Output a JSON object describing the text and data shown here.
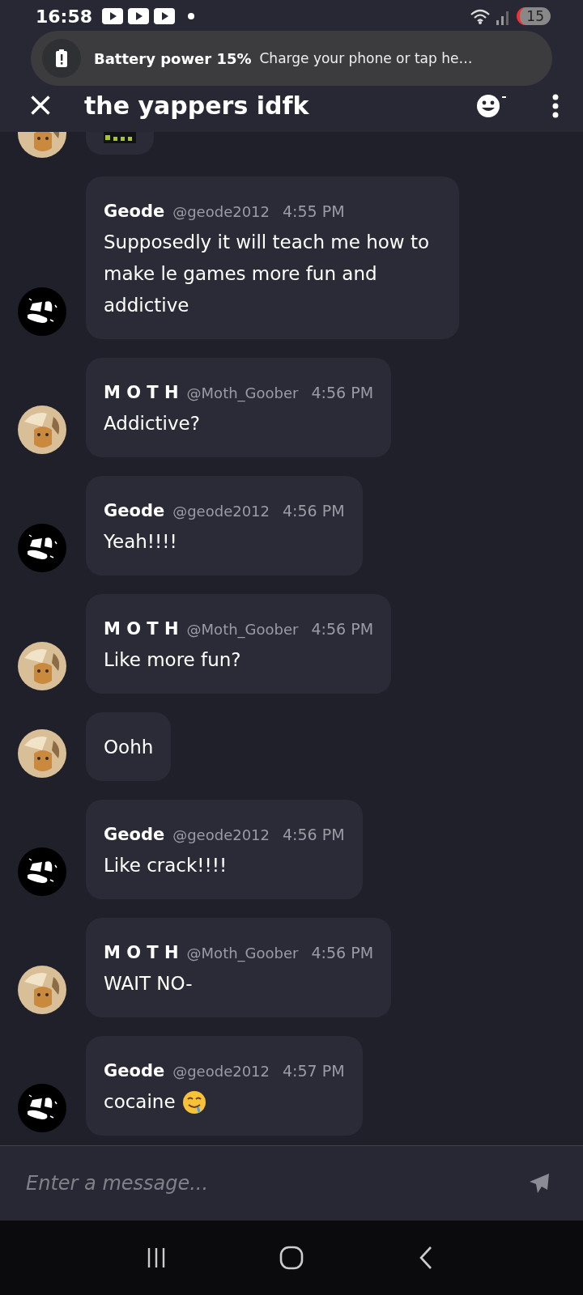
{
  "status_bar": {
    "time": "16:58",
    "battery": "15"
  },
  "notification": {
    "title": "Battery power 15%",
    "text": "Charge your phone or tap he…"
  },
  "header": {
    "title": "the yappers idfk"
  },
  "messages": [
    {
      "kind": "moth"
    },
    {
      "kind": "geode",
      "name": "Geode",
      "handle": "@geode2012",
      "time": "4:55 PM",
      "text": "Supposedly it will teach me how to make le games more fun and addictive",
      "emoji": false
    },
    {
      "kind": "moth",
      "name": "M O T H",
      "handle": "@Moth_Goober",
      "time": "4:56 PM",
      "text": "Addictive?",
      "emoji": false
    },
    {
      "kind": "geode",
      "name": "Geode",
      "handle": "@geode2012",
      "time": "4:56 PM",
      "text": "Yeah!!!!",
      "emoji": false
    },
    {
      "kind": "moth",
      "name": "M O T H",
      "handle": "@Moth_Goober",
      "time": "4:56 PM",
      "text": "Like more fun?",
      "emoji": false
    },
    {
      "kind": "moth",
      "text": "Oohh",
      "emoji": false
    },
    {
      "kind": "geode",
      "name": "Geode",
      "handle": "@geode2012",
      "time": "4:56 PM",
      "text": "Like crack!!!!",
      "emoji": false
    },
    {
      "kind": "moth",
      "name": "M O T H",
      "handle": "@Moth_Goober",
      "time": "4:56 PM",
      "text": "WAIT NO-",
      "emoji": false
    },
    {
      "kind": "geode",
      "name": "Geode",
      "handle": "@geode2012",
      "time": "4:57 PM",
      "text": "cocaine",
      "emoji": true
    }
  ],
  "composer": {
    "placeholder": "Enter a message..."
  }
}
